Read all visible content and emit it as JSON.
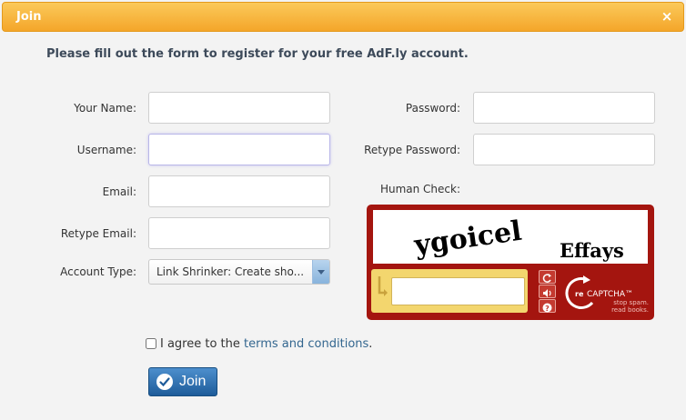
{
  "dialog": {
    "title": "Join",
    "close_glyph": "×"
  },
  "intro": "Please fill out the form to register for your free AdF.ly account.",
  "fields": {
    "name_label": "Your Name:",
    "username_label": "Username:",
    "email_label": "Email:",
    "retype_email_label": "Retype Email:",
    "account_type_label": "Account Type:",
    "account_type_value": "Link Shrinker: Create sho...",
    "password_label": "Password:",
    "retype_password_label": "Retype Password:",
    "human_check_label": "Human Check:"
  },
  "captcha": {
    "word1": "ygoicel",
    "word2": "Effays",
    "brand_re": "re",
    "brand_name": "CAPTCHA™",
    "tagline1": "stop spam.",
    "tagline2": "read books.",
    "icons": [
      "refresh-icon",
      "audio-icon",
      "help-icon"
    ]
  },
  "agree": {
    "prefix": "I agree to the",
    "link": "terms and conditions",
    "suffix": "."
  },
  "join_button": "Join",
  "colors": {
    "titlebar": "#f4a62a",
    "captcha_red": "#a4150f",
    "button_blue": "#2f6fb0",
    "link": "#33668f"
  }
}
